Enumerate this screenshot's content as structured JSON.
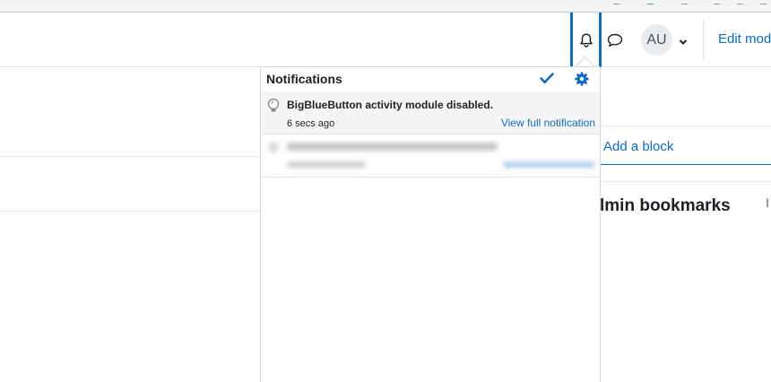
{
  "navbar": {
    "user_initials": "AU",
    "edit_mode_label": "Edit mod"
  },
  "drawer": {
    "add_block_label": "Add a block",
    "bookmarks_title": "lmin bookmarks"
  },
  "notifications": {
    "title": "Notifications",
    "items": [
      {
        "subject": "BigBlueButton activity module disabled.",
        "time": "6 secs ago",
        "link_label": "View full notification"
      }
    ]
  },
  "colors": {
    "accent": "#0f6cbf",
    "border": "#dee2e6",
    "unread_bg": "#f5f5f5"
  },
  "icons": {
    "bell": "bell-icon",
    "messages": "speech-bubble-icon",
    "chevron": "chevron-down-icon",
    "mark_read": "checkmark-icon",
    "preferences": "gear-icon",
    "notification": "lightbulb-icon"
  }
}
